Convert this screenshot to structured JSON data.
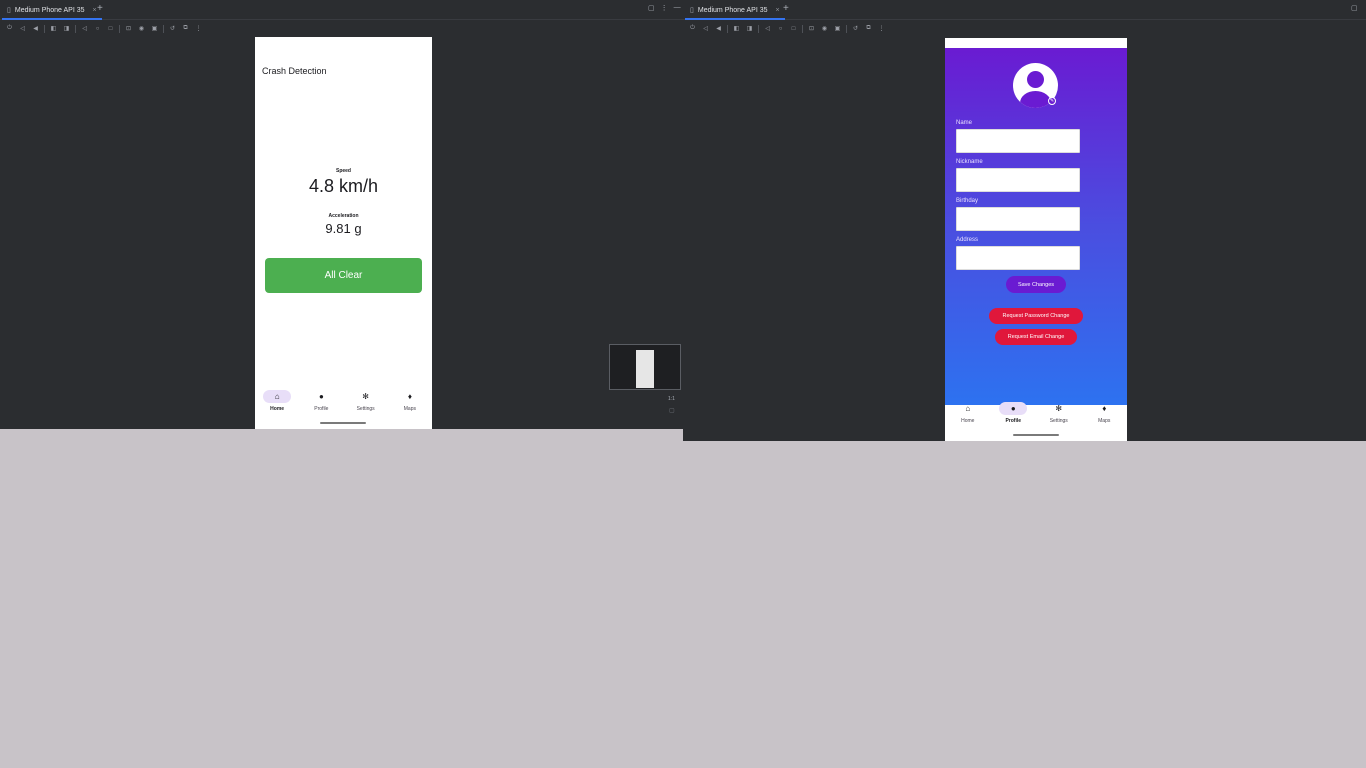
{
  "left_pane": {
    "tab_title": "Medium Phone API 35",
    "app": {
      "title": "Crash Detection",
      "speed_label": "Speed",
      "speed_value": "4.8 km/h",
      "accel_label": "Acceleration",
      "accel_value": "9.81 g",
      "status_button": "All Clear"
    },
    "nav": [
      {
        "label": "Home",
        "icon": "home-icon",
        "active": true
      },
      {
        "label": "Profile",
        "icon": "person-icon",
        "active": false
      },
      {
        "label": "Settings",
        "icon": "gear-icon",
        "active": false
      },
      {
        "label": "Maps",
        "icon": "map-pin-icon",
        "active": false
      }
    ],
    "zoom_label": "1:1"
  },
  "right_pane": {
    "tab_title": "Medium Phone API 35",
    "fields": [
      {
        "label": "Name",
        "value": ""
      },
      {
        "label": "Nickname",
        "value": ""
      },
      {
        "label": "Birthday",
        "value": ""
      },
      {
        "label": "Address",
        "value": ""
      }
    ],
    "save_button": "Save Changes",
    "password_button": "Request Password Change",
    "email_button": "Request Email Change",
    "nav": [
      {
        "label": "Home",
        "icon": "home-icon",
        "active": false
      },
      {
        "label": "Profile",
        "icon": "person-icon",
        "active": true
      },
      {
        "label": "Settings",
        "icon": "gear-icon",
        "active": false
      },
      {
        "label": "Maps",
        "icon": "map-pin-icon",
        "active": false
      }
    ]
  },
  "colors": {
    "ide_bg": "#2b2d30",
    "accent": "#3574f0",
    "all_clear": "#4caf50",
    "gradient_top": "#6a1bd2",
    "gradient_bottom": "#2d72f0",
    "danger": "#e0173b",
    "nav_active": "#e8def8"
  }
}
